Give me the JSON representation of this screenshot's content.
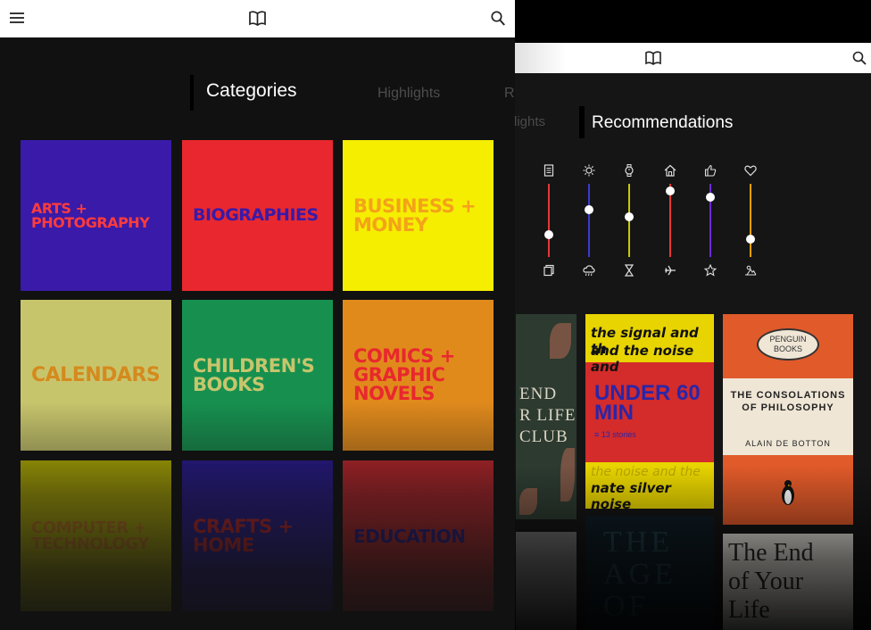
{
  "back_screen": {
    "tabs": {
      "previous": "lights",
      "active": "Recommendations"
    },
    "sliders": [
      {
        "top_icon": "document-icon",
        "bottom_icon": "copy-icon",
        "color": "#e53935",
        "level": 0.3
      },
      {
        "top_icon": "sun-icon",
        "bottom_icon": "rain-cloud-icon",
        "color": "#3b3bd6",
        "level": 0.65
      },
      {
        "top_icon": "watch-icon",
        "bottom_icon": "hourglass-icon",
        "color": "#c8c800",
        "level": 0.55
      },
      {
        "top_icon": "home-icon",
        "bottom_icon": "airplane-icon",
        "color": "#e53935",
        "level": 0.9
      },
      {
        "top_icon": "thumbs-up-icon",
        "bottom_icon": "star-icon",
        "color": "#6a2bd6",
        "level": 0.82
      },
      {
        "top_icon": "heart-icon",
        "bottom_icon": "sunset-icon",
        "color": "#e5a000",
        "level": 0.25
      }
    ],
    "books": {
      "book1_lines": [
        "END",
        "R LIFE",
        "CLUB"
      ],
      "book2": {
        "top_line1": "the signal and th",
        "top_line2": "and the noise and",
        "title": "UNDER 60 MIN",
        "stories": "13 stories",
        "bottom_line1": "the noise and the",
        "bottom_line2": "nate silver noise"
      },
      "book3": {
        "publisher_line1": "PENGUIN",
        "publisher_line2": "BOOKS",
        "title": "THE CONSOLATIONS OF PHILOSOPHY",
        "author": "ALAIN DE BOTTON"
      },
      "book5_lines": [
        "THE",
        "AGE OF"
      ],
      "book6_lines": [
        "The End",
        "of Your",
        "Life"
      ]
    }
  },
  "front_screen": {
    "tabs": {
      "active": "Categories",
      "second": "Highlights",
      "third": "R"
    },
    "categories": [
      {
        "label": "ARTS + PHOTOGRAPHY",
        "bg": "#3a1aa8",
        "fg": "#ff3b3b"
      },
      {
        "label": "BIOGRAPHIES",
        "bg": "#e8282e",
        "fg": "#3a1aa8"
      },
      {
        "label": "BUSINESS + MONEY",
        "bg": "#f5ee00",
        "fg": "#f3a21a"
      },
      {
        "label": "CALENDARS",
        "bg": "#c7c56c",
        "fg": "#d58a1e"
      },
      {
        "label": "CHILDREN'S BOOKS",
        "bg": "#17904f",
        "fg": "#c7c56c"
      },
      {
        "label": "COMICS + GRAPHIC NOVELS",
        "bg": "#e08a1c",
        "fg": "#e8282e"
      },
      {
        "label": "COMPUTER + TECHNOLOGY",
        "bg": "#c9c400",
        "fg": "#e08a1c"
      },
      {
        "label": "CRAFTS + HOME",
        "bg": "#2a1aa0",
        "fg": "#e8282e"
      },
      {
        "label": "EDUCATION",
        "bg": "#d4282e",
        "fg": "#2a1aa0"
      }
    ]
  }
}
